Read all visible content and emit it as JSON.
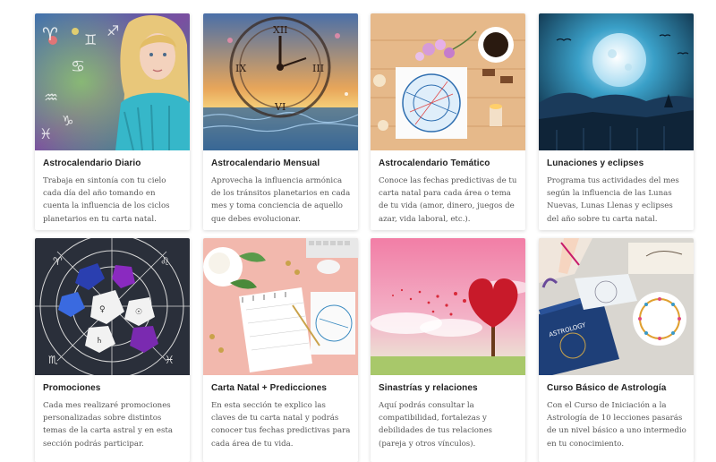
{
  "cards": [
    {
      "image": "woman-zodiac-image",
      "title": "Astrocalendario Diario",
      "text": "Trabaja en sintonía con tu cielo cada día del año tomando en cuenta la influencia de los ciclos planetarios en tu carta natal."
    },
    {
      "image": "clock-sea-image",
      "title": "Astrocalendario Mensual",
      "text": "Aprovecha la influencia armónica de los tránsitos planetarios en cada mes y toma conciencia de aquello que debes evolucionar."
    },
    {
      "image": "birth-chart-desk-image",
      "title": "Astrocalendario Temático",
      "text": "Conoce las fechas predictivas de tu carta natal para cada área o tema de tu vida (amor, dinero, juegos de azar, vida laboral, etc.)."
    },
    {
      "image": "moon-night-image",
      "title": "Lunaciones y eclipses",
      "text": "Programa tus actividades del mes según la influencia de las Lunas Nuevas, Lunas Llenas y eclipses del año sobre tu carta natal."
    },
    {
      "image": "astro-dice-image",
      "title": "Promociones",
      "text": "Cada mes realizaré promociones personalizadas sobre distintos temas de la carta astral y en esta sección podrás participar."
    },
    {
      "image": "notebook-flowers-image",
      "title": "Carta Natal + Predicciones",
      "text": "En esta sección te explico las claves de tu carta natal y podrás conocer tus fechas predictivas para cada área de tu vida."
    },
    {
      "image": "heart-tree-image",
      "title": "Sinastrías y relaciones",
      "text": "Aquí podrás consultar la compatibilidad, fortalezas y debilidades de tus relaciones (pareja y otros vínculos)."
    },
    {
      "image": "astrology-book-image",
      "title": "Curso Básico de Astrología",
      "text": "Con el Curso de Iniciación a la Astrología de 10 lecciones pasarás de un nivel básico a uno intermedio en tu conocimiento."
    }
  ]
}
